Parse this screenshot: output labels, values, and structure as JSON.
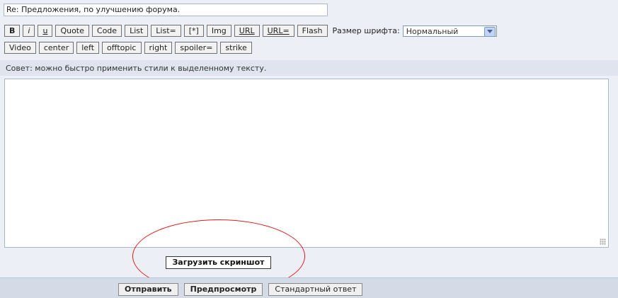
{
  "subject": {
    "value": "Re: Предложения, по улучшению форума."
  },
  "toolbar": {
    "row1": [
      {
        "label": "B",
        "name": "bold-button",
        "cls": "b"
      },
      {
        "label": "i",
        "name": "italic-button",
        "cls": "i"
      },
      {
        "label": "u",
        "name": "underline-button",
        "cls": "u"
      },
      {
        "label": "Quote",
        "name": "quote-button",
        "cls": ""
      },
      {
        "label": "Code",
        "name": "code-button",
        "cls": ""
      },
      {
        "label": "List",
        "name": "list-button",
        "cls": ""
      },
      {
        "label": "List=",
        "name": "list-numbered-button",
        "cls": ""
      },
      {
        "label": "[*]",
        "name": "list-item-button",
        "cls": ""
      },
      {
        "label": "Img",
        "name": "img-button",
        "cls": ""
      },
      {
        "label": "URL",
        "name": "url-button",
        "cls": "url"
      },
      {
        "label": "URL=",
        "name": "url-named-button",
        "cls": "url"
      },
      {
        "label": "Flash",
        "name": "flash-button",
        "cls": ""
      }
    ],
    "row2": [
      {
        "label": "Video",
        "name": "video-button"
      },
      {
        "label": "center",
        "name": "center-button"
      },
      {
        "label": "left",
        "name": "left-button"
      },
      {
        "label": "offtopic",
        "name": "offtopic-button"
      },
      {
        "label": "right",
        "name": "right-button"
      },
      {
        "label": "spoiler=",
        "name": "spoiler-button"
      },
      {
        "label": "strike",
        "name": "strike-button"
      }
    ],
    "font_size_label": "Размер шрифта:",
    "font_size_value": "Нормальный"
  },
  "hint": "Совет: можно быстро применить стили к выделенному тексту.",
  "upload_label": "Загрузить скриншот",
  "footer": {
    "submit": "Отправить",
    "preview": "Предпросмотр",
    "standard": "Стандартный ответ"
  },
  "colors": {
    "annotation_circle": "#e11919"
  }
}
